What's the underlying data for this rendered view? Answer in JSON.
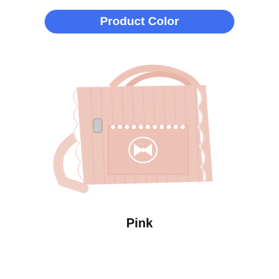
{
  "header": {
    "title": "Product Color",
    "background": "#3f6ef0"
  },
  "product": {
    "image_icon": "pink-pet-carrier-bag-icon",
    "color_name": "Pink",
    "bag_color": "#efc8bd",
    "accent_color": "#ffffff"
  }
}
